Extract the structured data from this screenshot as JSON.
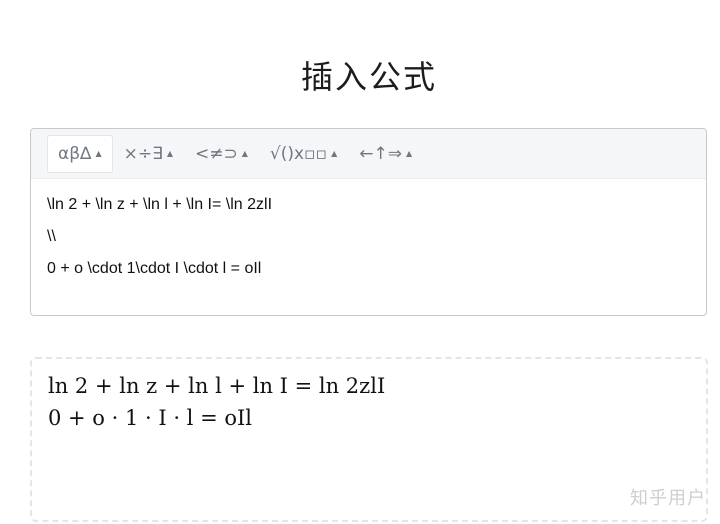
{
  "page": {
    "title": "插入公式"
  },
  "toolbar": {
    "buttons": [
      {
        "label": "αβ∆",
        "caret": "▲"
      },
      {
        "label": "×÷∃",
        "caret": "▲"
      },
      {
        "label": "<≠⊃",
        "caret": "▲"
      },
      {
        "label": "√()x▫▫",
        "caret": "▲"
      },
      {
        "label": "←↑⇒",
        "caret": "▲"
      }
    ]
  },
  "editor": {
    "lines": [
      "\\ln 2 + \\ln z + \\ln l + \\ln I= \\ln 2zlI",
      "\\\\",
      "0 + o \\cdot 1\\cdot I \\cdot l = oIl"
    ]
  },
  "preview": {
    "lines": [
      "ln 2 + ln z + ln l + ln I = ln 2zlI",
      "0 + o · 1 · I · l = oIl"
    ]
  },
  "watermark": {
    "text": "知乎用户"
  }
}
